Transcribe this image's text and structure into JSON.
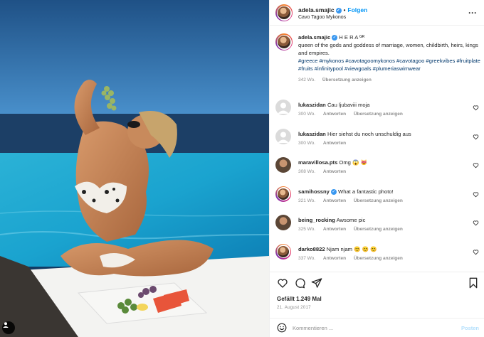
{
  "header": {
    "username": "adela.smajic",
    "separator": "•",
    "follow_label": "Folgen",
    "location": "Cavo Tagoo Mykonos",
    "more_icon": "more-horizontal-icon"
  },
  "caption": {
    "username": "adela.smajic",
    "title": "H E R A ᴳᴿ",
    "text": "queen of the gods and goddess of marriage, women, childbirth, heirs, kings and empires.",
    "hashtags": "#greece #mykonos #cavotagoomykonos #cavotagoo #greekvibes #fruitplate #fruits #infinitypool #viewgoals #plumeriaswimwear",
    "age": "342 Wo.",
    "translate_label": "Übersetzung anzeigen"
  },
  "comments": [
    {
      "username": "lukaszidan",
      "text": "Ćau ljubaviii moja",
      "age": "300 Wo.",
      "reply": "Antworten",
      "translate": "Übersetzung anzeigen",
      "avatar": "default",
      "verified": false
    },
    {
      "username": "lukaszidan",
      "text": "Hier siehst du noch unschuldig aus",
      "age": "300 Wo.",
      "reply": "Antworten",
      "translate": "",
      "avatar": "default",
      "verified": false
    },
    {
      "username": "maravillosa.pts",
      "text": "Omg 😱 😻",
      "age": "308 Wo.",
      "reply": "Antworten",
      "translate": "",
      "avatar": "photo",
      "verified": false
    },
    {
      "username": "samihossny",
      "text": "What a fantastic photo!",
      "age": "321 Wo.",
      "reply": "Antworten",
      "translate": "Übersetzung anzeigen",
      "avatar": "ring",
      "verified": true
    },
    {
      "username": "being_rocking",
      "text": "Awsome pic",
      "age": "325 Wo.",
      "reply": "Antworten",
      "translate": "Übersetzung anzeigen",
      "avatar": "photo",
      "verified": false
    },
    {
      "username": "darko8822",
      "text": "Njam njam 😊 😊 😊",
      "age": "337 Wo.",
      "reply": "Antworten",
      "translate": "Übersetzung anzeigen",
      "avatar": "ring",
      "verified": false
    }
  ],
  "actions": {
    "like_icon": "heart-icon",
    "comment_icon": "comment-icon",
    "share_icon": "paper-plane-icon",
    "save_icon": "bookmark-icon"
  },
  "likes": "Gefällt 1.249 Mal",
  "date": "21. August 2017",
  "add_comment": {
    "placeholder": "Kommentieren ...",
    "post_label": "Posten",
    "emoji_icon": "smiley-icon"
  },
  "colors": {
    "link": "#00376b",
    "follow": "#0095f6",
    "secondary": "#8e8e8e",
    "post_disabled": "#b2dffc"
  }
}
